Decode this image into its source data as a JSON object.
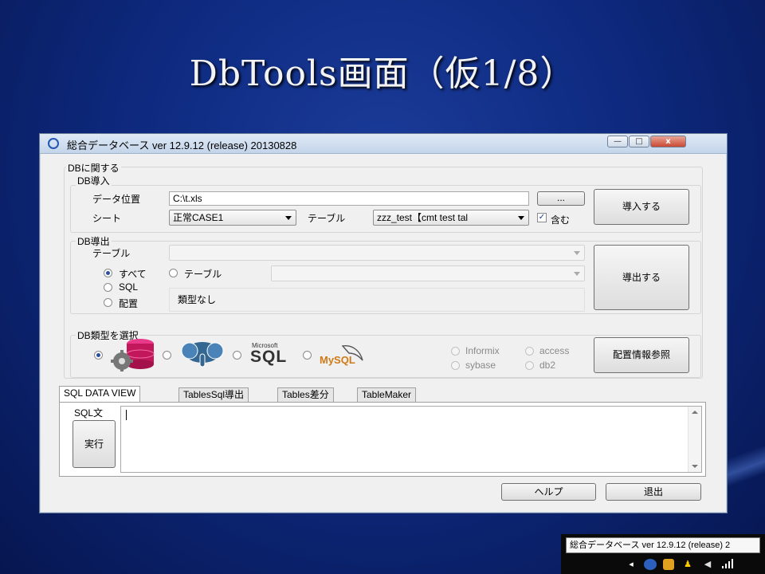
{
  "slide": {
    "title": "DbTools画面（仮1/8）"
  },
  "window": {
    "title": "総合データベース ver 12.9.12 (release) 20130828",
    "controls": {
      "minimize": "—",
      "maximize": "□",
      "close": "x"
    }
  },
  "db_group": {
    "legend": "DBに関する"
  },
  "import": {
    "legend": "DB導入",
    "data_location_label": "データ位置",
    "data_location_value": "C:\\t.xls",
    "browse_label": "...",
    "sheet_label": "シート",
    "sheet_value": "正常CASE1",
    "table_label": "テーブル",
    "table_value": "zzz_test【cmt test tal",
    "include_label": "含む",
    "include_checked": true,
    "import_button": "導入する"
  },
  "export": {
    "legend": "DB導出",
    "table_label": "テーブル",
    "table_value": "",
    "radio_all": "すべて",
    "radio_table": "テーブル",
    "radio_sql": "SQL",
    "radio_config": "配置",
    "selected": "すべて",
    "type_text": "類型なし",
    "export_button": "導出する"
  },
  "db_type": {
    "legend": "DB類型を選択",
    "selected": "oracle",
    "logos": [
      "oracle",
      "postgresql",
      "sqlserver",
      "mysql"
    ],
    "sqlserver_small": "Microsoft",
    "sqlserver_big": "SQL",
    "mysql_text": "MySQL",
    "other_options": [
      "Informix",
      "access",
      "sybase",
      "db2"
    ],
    "config_button": "配置情報参照"
  },
  "tabs": [
    "SQL DATA VIEW",
    "TablesSql導出",
    "Tables差分",
    "TableMaker"
  ],
  "active_tab": "SQL DATA VIEW",
  "sql_panel": {
    "label": "SQL文",
    "execute_button": "実行",
    "text": ""
  },
  "footer": {
    "help_button": "ヘルプ",
    "exit_button": "退出"
  },
  "taskbar": {
    "tooltip": "総合データベース ver 12.9.12 (release) 2"
  },
  "colors": {
    "accent": "#2357b5",
    "close": "#c94a33",
    "background": "#0e2a80"
  }
}
